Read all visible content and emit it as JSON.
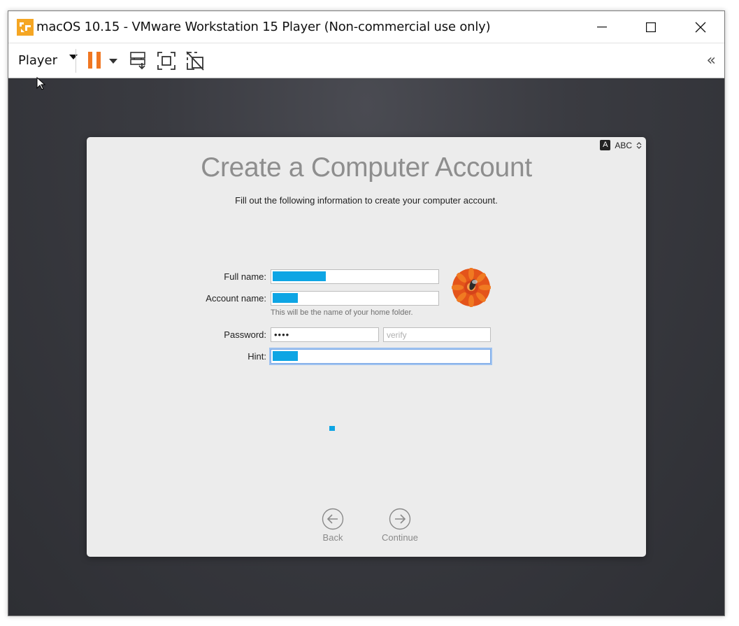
{
  "window": {
    "title": "macOS 10.15 - VMware Workstation 15 Player (Non-commercial use only)",
    "controls": [
      "minimize",
      "maximize",
      "close"
    ]
  },
  "toolbar": {
    "player_menu": "Player",
    "tools": [
      "pause-icon",
      "send-ctrl-alt-del-icon",
      "full-screen-icon",
      "unity-icon"
    ],
    "collapse": "«"
  },
  "setup": {
    "input_source": {
      "badge": "A",
      "label": "ABC"
    },
    "title": "Create a Computer Account",
    "subtitle": "Fill out the following information to create your computer account.",
    "fields": {
      "full_name_label": "Full name:",
      "account_name_label": "Account name:",
      "account_name_note": "This will be the name of your home folder.",
      "password_label": "Password:",
      "password_value": "••••",
      "verify_placeholder": "verify",
      "hint_label": "Hint:"
    },
    "back_label": "Back",
    "continue_label": "Continue"
  },
  "colors": {
    "redaction": "#0ea5e4",
    "pause_accent": "#f07722",
    "focus_ring": "#9ec2f0"
  }
}
